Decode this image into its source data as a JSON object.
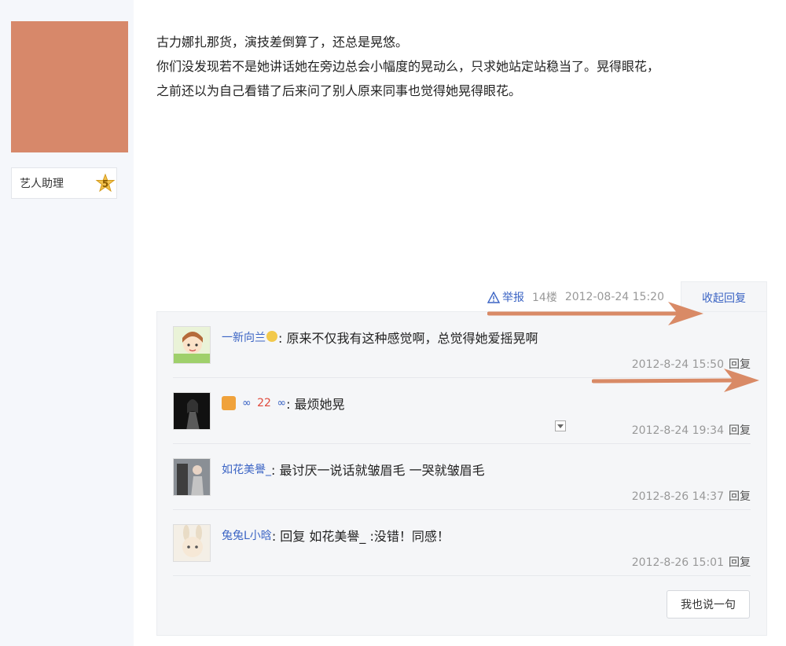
{
  "author": {
    "title": "艺人助理",
    "level": "5"
  },
  "post": {
    "lines": [
      "古力娜扎那货，演技差倒算了，还总是晃悠。",
      "你们没发现若不是她讲话她在旁边总会小幅度的晃动么，只求她站定站稳当了。晃得眼花，",
      "之前还以为自己看错了后来问了别人原来同事也觉得她晃得眼花。"
    ],
    "report_label": "举报",
    "floor": "14楼",
    "datetime": "2012-08-24 15:20",
    "collapse_label": "收起回复"
  },
  "replies": [
    {
      "name": "一新向兰",
      "text": ": 原来不仅我有这种感觉啊，总觉得她爱摇晃啊",
      "time": "2012-8-24 15:50",
      "reply_label": "回复"
    },
    {
      "name_prefix": "∞",
      "name_num": "22",
      "name_suffix": "∞",
      "text": ": 最烦她晃",
      "time": "2012-8-24 19:34",
      "reply_label": "回复"
    },
    {
      "name": "如花美譽_",
      "text": ": 最讨厌一说话就皱眉毛 一哭就皱眉毛",
      "time": "2012-8-26 14:37",
      "reply_label": "回复"
    },
    {
      "name": "兔兔L小晗",
      "text": ": 回复 如花美譽_ :没错！同感！",
      "time": "2012-8-26 15:01",
      "reply_label": "回复"
    }
  ],
  "say_button": "我也说一句",
  "colors": {
    "link": "#3b64c4",
    "avatar_placeholder": "#d7886a",
    "annotation_arrow": "#d98a66",
    "panel_bg": "#f5f6f8"
  }
}
